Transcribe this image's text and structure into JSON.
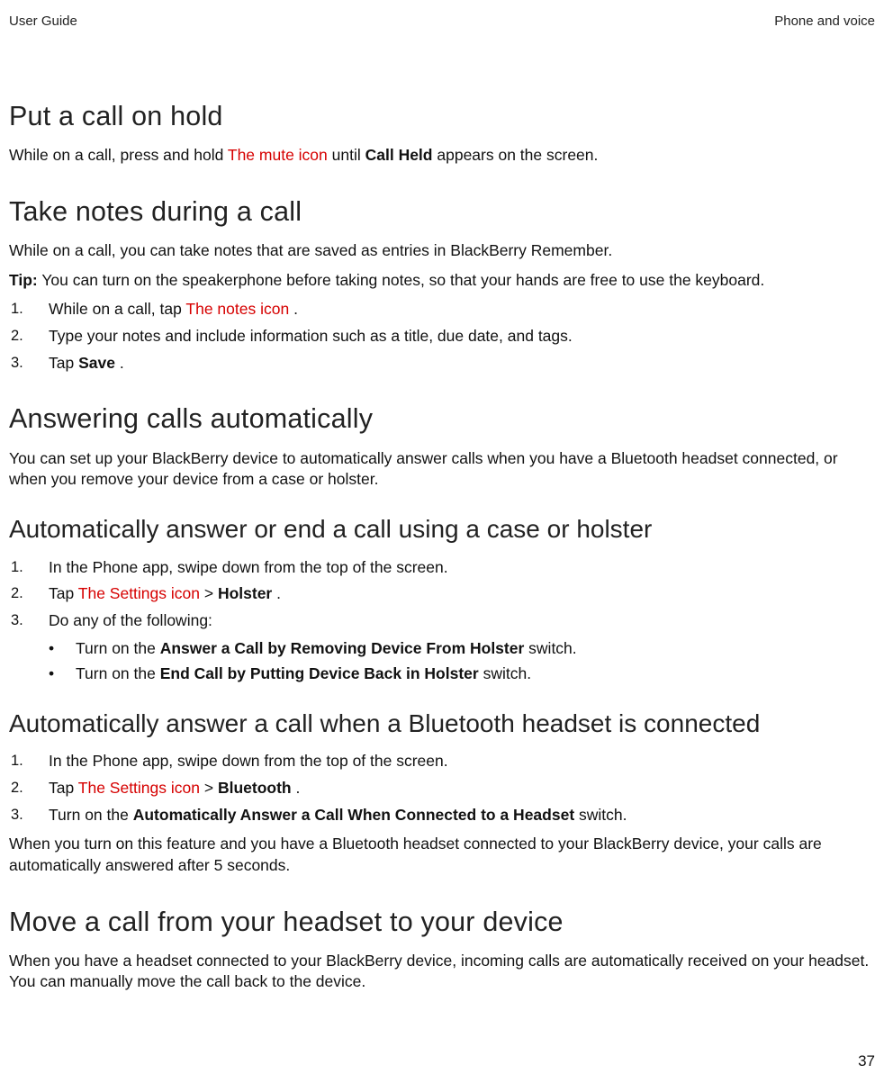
{
  "header": {
    "left": "User Guide",
    "right": "Phone and voice"
  },
  "s1": {
    "title": "Put a call on hold",
    "p_a": "While on a call, press and hold ",
    "icon": "The mute icon",
    "p_b": " until ",
    "bold": "Call Held",
    "p_c": " appears on the screen."
  },
  "s2": {
    "title": "Take notes during a call",
    "p1": "While on a call, you can take notes that are saved as entries in BlackBerry Remember.",
    "tip_label": "Tip:",
    "tip_text": " You can turn on the speakerphone before taking notes, so that your hands are free to use the keyboard.",
    "list": {
      "n1": "1.",
      "i1_a": "While on a call, tap ",
      "i1_icon": "The notes icon",
      "i1_b": " .",
      "n2": "2.",
      "i2": "Type your notes and include information such as a title, due date, and tags.",
      "n3": "3.",
      "i3_a": "Tap ",
      "i3_bold": "Save",
      "i3_b": "."
    }
  },
  "s3": {
    "title": "Answering calls automatically",
    "p1": "You can set up your BlackBerry device to automatically answer calls when you have a Bluetooth headset connected, or when you remove your device from a case or holster."
  },
  "s4": {
    "title": "Automatically answer or end a call using a case or holster",
    "list": {
      "n1": "1.",
      "i1": "In the Phone app, swipe down from the top of the screen.",
      "n2": "2.",
      "i2_a": "Tap ",
      "i2_icon": "The Settings icon",
      "i2_b": " > ",
      "i2_bold": "Holster",
      "i2_c": ".",
      "n3": "3.",
      "i3": "Do any of the following:"
    },
    "bullets": {
      "dot": "•",
      "b1_a": "Turn on the ",
      "b1_bold": "Answer a Call by Removing Device From Holster",
      "b1_b": " switch.",
      "b2_a": "Turn on the ",
      "b2_bold": "End Call by Putting Device Back in Holster",
      "b2_b": " switch."
    }
  },
  "s5": {
    "title": "Automatically answer a call when a Bluetooth headset is connected",
    "list": {
      "n1": "1.",
      "i1": "In the Phone app, swipe down from the top of the screen.",
      "n2": "2.",
      "i2_a": "Tap ",
      "i2_icon": "The Settings icon",
      "i2_b": " > ",
      "i2_bold": "Bluetooth",
      "i2_c": ".",
      "n3": "3.",
      "i3_a": "Turn on the ",
      "i3_bold": "Automatically Answer a Call When Connected to a Headset",
      "i3_b": " switch."
    },
    "p1": "When you turn on this feature and you have a Bluetooth headset connected to your BlackBerry device, your calls are automatically answered after 5 seconds."
  },
  "s6": {
    "title": "Move a call from your headset to your device",
    "p1": "When you have a headset connected to your BlackBerry device, incoming calls are automatically received on your headset. You can manually move the call back to the device."
  },
  "page_num": "37"
}
